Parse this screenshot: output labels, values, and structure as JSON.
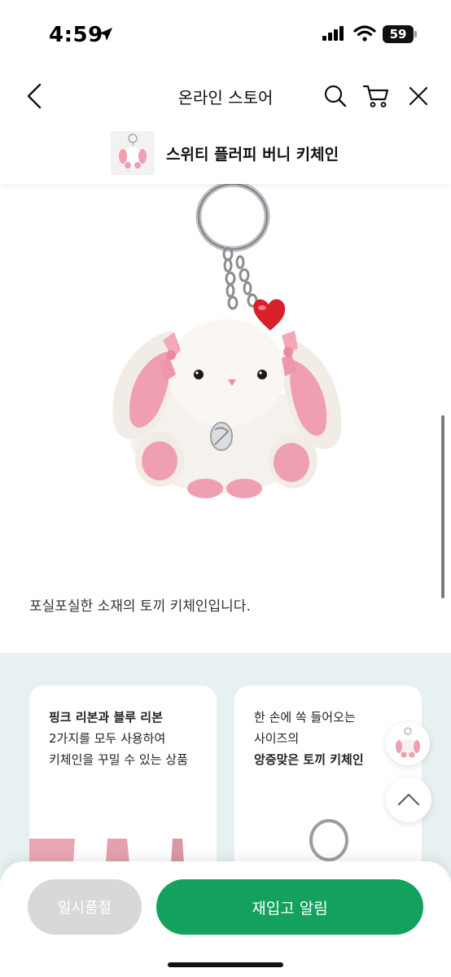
{
  "status": {
    "time": "4:59",
    "battery": "59"
  },
  "nav": {
    "title": "온라인 스토어"
  },
  "product": {
    "name": "스위티 플러피 버니 키체인"
  },
  "description": "포실포실한 소재의 토끼 키체인입니다.",
  "cards": [
    {
      "lines": [
        {
          "text": "핑크 리본과 블루 리본",
          "bold": true
        },
        {
          "text": "2가지를 모두 사용하여",
          "bold": false
        },
        {
          "text": "키체인을 꾸밀 수 있는 상품",
          "bold": false
        }
      ]
    },
    {
      "lines": [
        {
          "text": "한 손에 쏙 들어오는",
          "bold": false
        },
        {
          "text": "사이즈의",
          "bold": false
        },
        {
          "text": "앙증맞은 토끼 키체인",
          "bold": true
        }
      ]
    }
  ],
  "buttons": {
    "soldout": "일시품절",
    "restock": "재입고 알림"
  },
  "colors": {
    "accent": "#13a15e",
    "section_bg": "#e7f1f1",
    "disabled": "#d8d8d8",
    "bunny_pink": "#ef9fb0"
  },
  "icons": [
    "location-arrow-icon",
    "signal-icon",
    "wifi-icon",
    "battery-icon",
    "back-icon",
    "search-icon",
    "cart-icon",
    "close-icon",
    "chevron-up-icon"
  ]
}
